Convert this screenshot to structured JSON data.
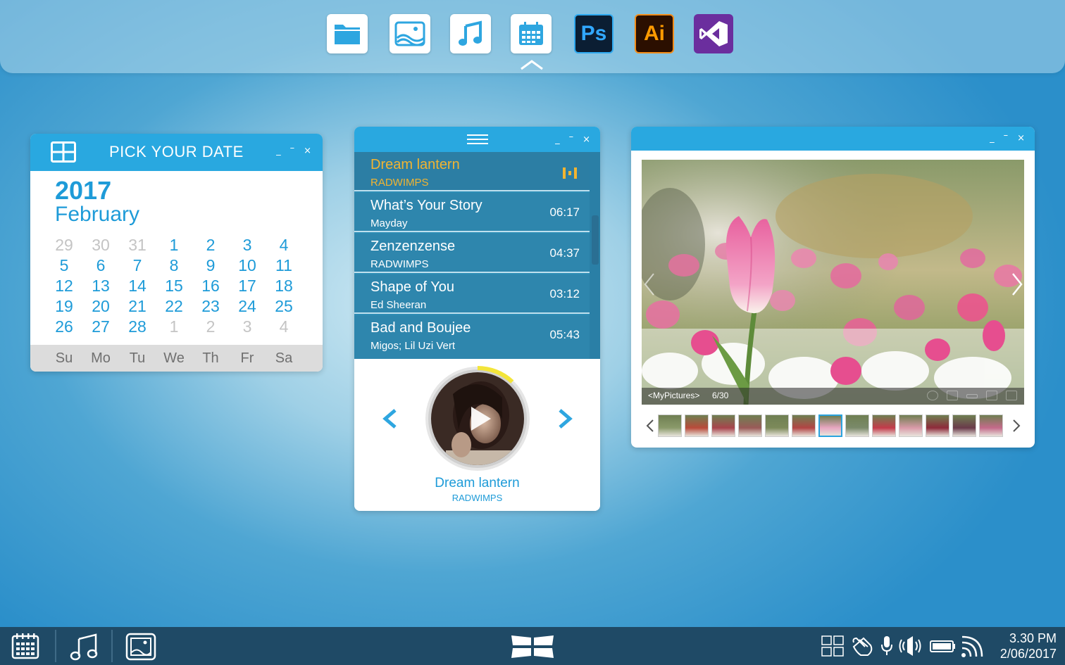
{
  "dock": {
    "apps": [
      {
        "name": "files",
        "icon": "folder-icon"
      },
      {
        "name": "photos",
        "icon": "image-icon"
      },
      {
        "name": "music",
        "icon": "music-note-icon"
      },
      {
        "name": "calendar",
        "icon": "calendar-icon"
      },
      {
        "name": "photoshop",
        "icon": "photoshop-icon",
        "label": "Ps"
      },
      {
        "name": "illustrator",
        "icon": "illustrator-icon",
        "label": "Ai"
      },
      {
        "name": "visual-studio",
        "icon": "visual-studio-icon"
      }
    ],
    "colors": {
      "icon_blue": "#2ea6e0",
      "ps_bg": "#0b1e33",
      "ai_bg": "#2b0f00",
      "vs_bg": "#6b2e9e"
    }
  },
  "calendar": {
    "title": "PICK YOUR DATE",
    "year": "2017",
    "month": "February",
    "days": [
      {
        "d": "29",
        "muted": true
      },
      {
        "d": "30",
        "muted": true
      },
      {
        "d": "31",
        "muted": true
      },
      {
        "d": "1"
      },
      {
        "d": "2"
      },
      {
        "d": "3"
      },
      {
        "d": "4"
      },
      {
        "d": "5"
      },
      {
        "d": "6"
      },
      {
        "d": "7"
      },
      {
        "d": "8"
      },
      {
        "d": "9"
      },
      {
        "d": "10"
      },
      {
        "d": "11"
      },
      {
        "d": "12"
      },
      {
        "d": "13"
      },
      {
        "d": "14"
      },
      {
        "d": "15"
      },
      {
        "d": "16"
      },
      {
        "d": "17"
      },
      {
        "d": "18"
      },
      {
        "d": "19"
      },
      {
        "d": "20"
      },
      {
        "d": "21"
      },
      {
        "d": "22"
      },
      {
        "d": "23"
      },
      {
        "d": "24"
      },
      {
        "d": "25"
      },
      {
        "d": "26"
      },
      {
        "d": "27"
      },
      {
        "d": "28"
      },
      {
        "d": "1",
        "muted": true
      },
      {
        "d": "2",
        "muted": true
      },
      {
        "d": "3",
        "muted": true
      },
      {
        "d": "4",
        "muted": true
      }
    ],
    "weekdays": [
      "Su",
      "Mo",
      "Tu",
      "We",
      "Th",
      "Fr",
      "Sa"
    ],
    "accent": "#1e9bd8"
  },
  "music": {
    "tracks": [
      {
        "title": "Dream lantern",
        "artist": "RADWIMPS",
        "duration": "",
        "active": true
      },
      {
        "title": "What’s Your Story",
        "artist": "Mayday",
        "duration": "06:17"
      },
      {
        "title": "Zenzenzense",
        "artist": "RADWIMPS",
        "duration": "04:37"
      },
      {
        "title": "Shape of You",
        "artist": "Ed Sheeran",
        "duration": "03:12"
      },
      {
        "title": "Bad and Boujee",
        "artist": "Migos; Lil Uzi Vert",
        "duration": "05:43"
      }
    ],
    "now_playing": {
      "title": "Dream lantern",
      "artist": "RADWIMPS",
      "progress": 0.12
    },
    "active_color": "#f2b431"
  },
  "photos": {
    "caption": "<MyPictures>",
    "counter": "6/30",
    "selected_thumb": 6,
    "thumb_count": 13
  },
  "taskbar": {
    "time": "3.30 PM",
    "date": "2/06/2017",
    "bg": "#1f4a66"
  }
}
